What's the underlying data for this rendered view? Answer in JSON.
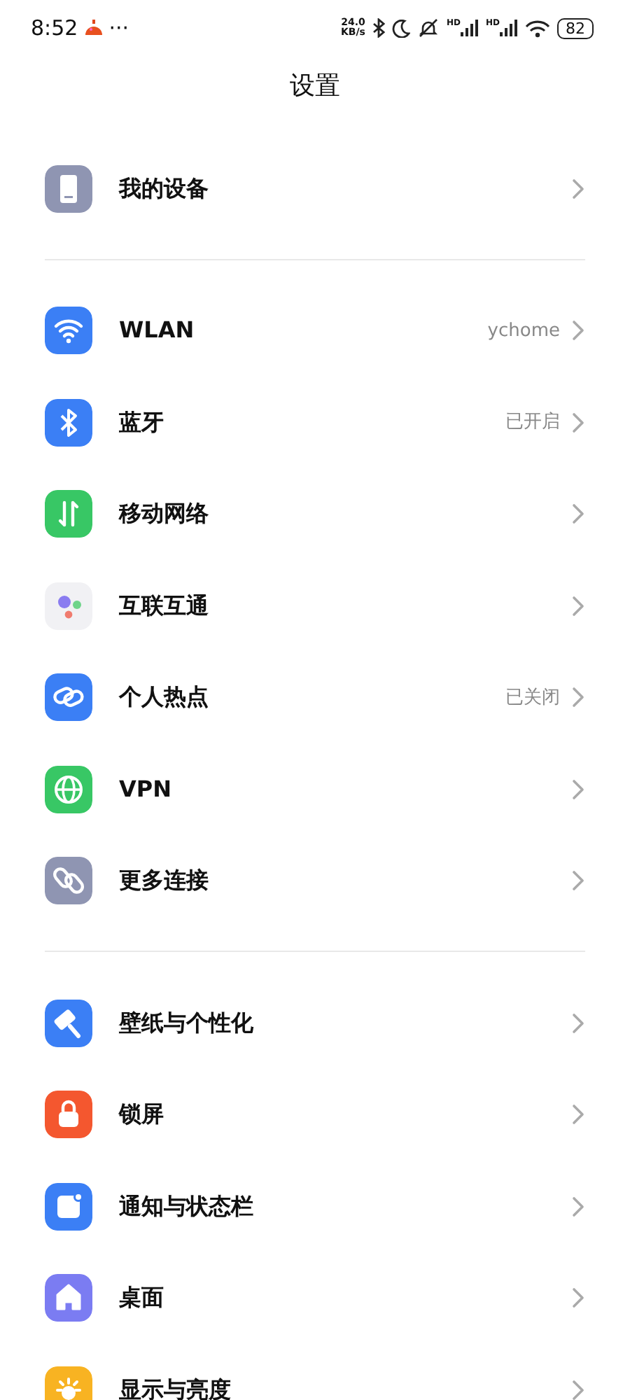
{
  "status_bar": {
    "time": "8:52",
    "more": "···",
    "speed_value": "24.0",
    "speed_unit": "KB/s",
    "signals": [
      {
        "label": "HD"
      },
      {
        "label": "HD"
      }
    ],
    "battery": "82"
  },
  "title": "设置",
  "groups": [
    {
      "items": [
        {
          "kind": "device",
          "label": "我的设备"
        }
      ]
    },
    {
      "items": [
        {
          "kind": "wifi",
          "label": "WLAN",
          "value": "ychome"
        },
        {
          "kind": "bluetooth",
          "label": "蓝牙",
          "value": "已开启"
        },
        {
          "kind": "mobile",
          "label": "移动网络"
        },
        {
          "kind": "interconnect",
          "label": "互联互通"
        },
        {
          "kind": "hotspot",
          "label": "个人热点",
          "value": "已关闭"
        },
        {
          "kind": "vpn",
          "label": "VPN"
        },
        {
          "kind": "more",
          "label": "更多连接"
        }
      ]
    },
    {
      "items": [
        {
          "kind": "wallpaper",
          "label": "壁纸与个性化"
        },
        {
          "kind": "lock",
          "label": "锁屏"
        },
        {
          "kind": "notification",
          "label": "通知与状态栏"
        },
        {
          "kind": "home",
          "label": "桌面"
        },
        {
          "kind": "display",
          "label": "显示与亮度"
        }
      ]
    }
  ]
}
